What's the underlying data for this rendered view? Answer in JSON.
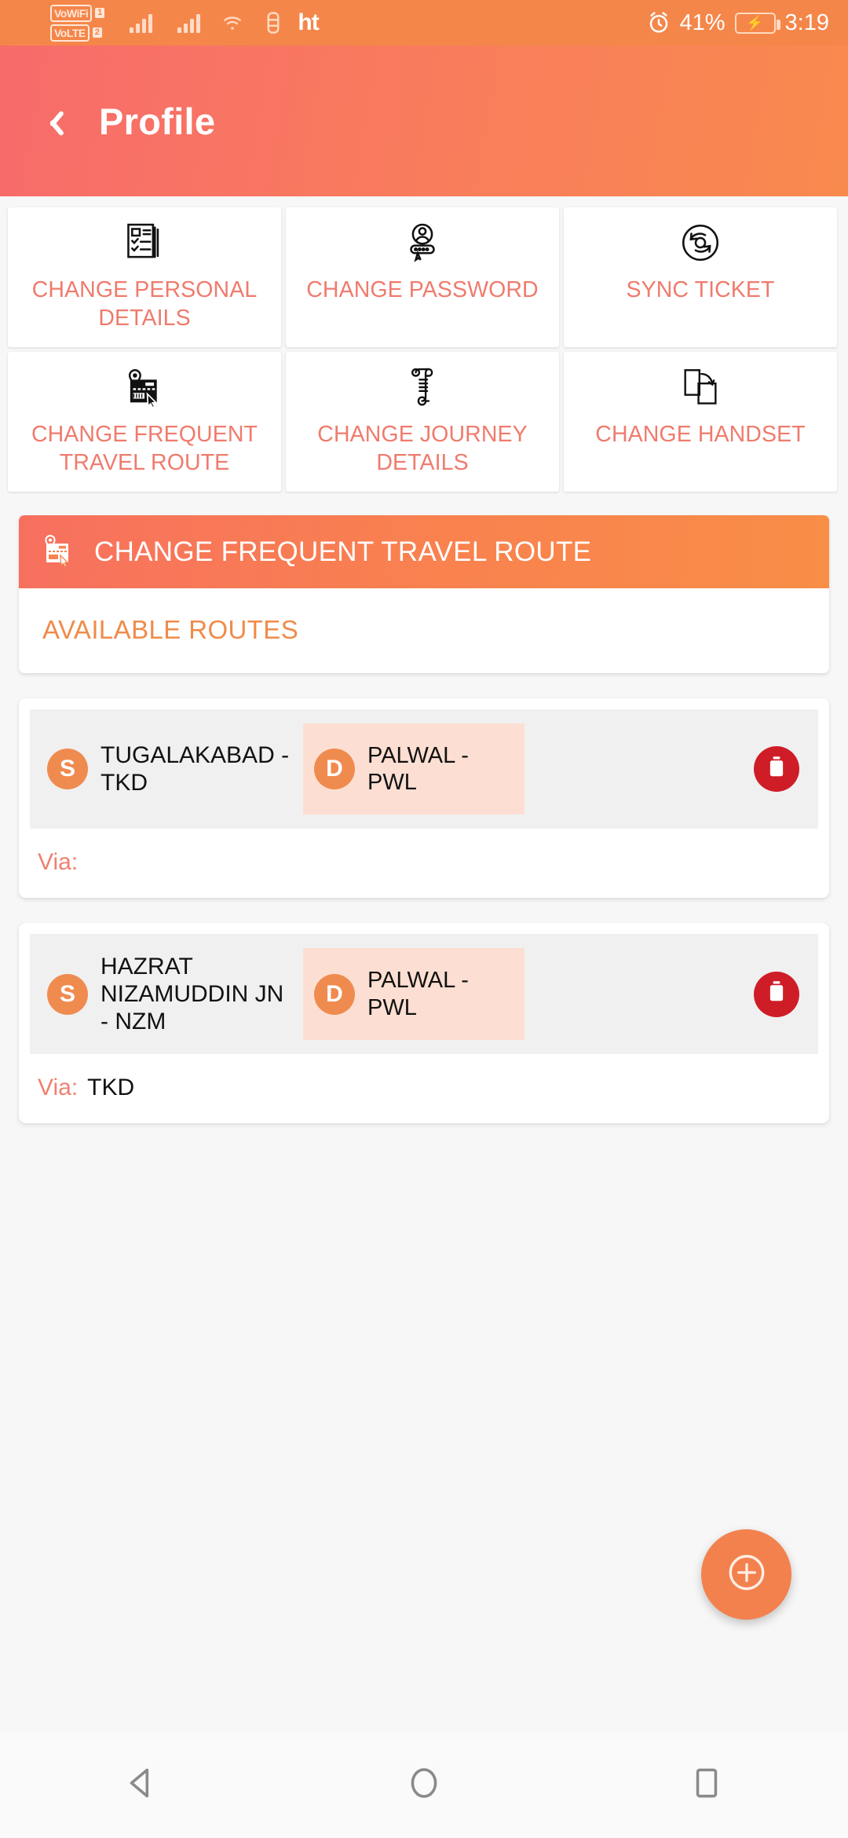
{
  "status_bar": {
    "vo_wifi_label": "VoWiFi",
    "vo_wifi_sim": "1",
    "volte_label": "VoLTE",
    "volte_sim": "2",
    "carrier": "ht",
    "battery_percent": "41%",
    "time": "3:19",
    "icons": [
      "signal-bars-sim1",
      "signal-bars-sim2",
      "wifi-icon",
      "vpn-icon",
      "alarm-icon",
      "battery-charging-icon"
    ]
  },
  "app_bar": {
    "title": "Profile",
    "back_icon": "chevron-left-icon"
  },
  "quick_actions": [
    {
      "label": "CHANGE PERSONAL DETAILS",
      "icon": "documents-checklist-icon"
    },
    {
      "label": "CHANGE PASSWORD",
      "icon": "user-password-icon"
    },
    {
      "label": "SYNC TICKET",
      "icon": "sync-circular-arrows-icon"
    },
    {
      "label": "CHANGE FREQUENT TRAVEL ROUTE",
      "icon": "route-map-pointer-icon"
    },
    {
      "label": "CHANGE JOURNEY DETAILS",
      "icon": "scroll-ticket-icon"
    },
    {
      "label": "CHANGE HANDSET",
      "icon": "handset-transfer-icon"
    }
  ],
  "panel": {
    "header_title": "CHANGE FREQUENT TRAVEL ROUTE",
    "header_icon": "route-map-pointer-icon",
    "subtitle": "AVAILABLE ROUTES"
  },
  "routes": [
    {
      "source_badge": "S",
      "source": "TUGALAKABAD - TKD",
      "dest_badge": "D",
      "destination": "PALWAL - PWL",
      "via_label": "Via:",
      "via_value": "",
      "delete_icon": "trash-icon"
    },
    {
      "source_badge": "S",
      "source": "HAZRAT NIZAMUDDIN JN - NZM",
      "dest_badge": "D",
      "destination": "PALWAL - PWL",
      "via_label": "Via:",
      "via_value": "TKD",
      "delete_icon": "trash-icon"
    }
  ],
  "fab": {
    "icon": "plus-circle-icon",
    "label": "+"
  },
  "nav_bar": {
    "back": "back-triangle-icon",
    "home": "home-circle-icon",
    "recents": "recents-square-icon"
  },
  "colors": {
    "accent_orange": "#f3814e",
    "accent_red": "#f76b6b",
    "label_salmon": "#ef7b6d",
    "subtitle_orange": "#f08b4a",
    "dest_bg_pink": "#fcdfd2",
    "delete_red": "#cf1d28",
    "status_bar_bg": "#f5864a"
  }
}
